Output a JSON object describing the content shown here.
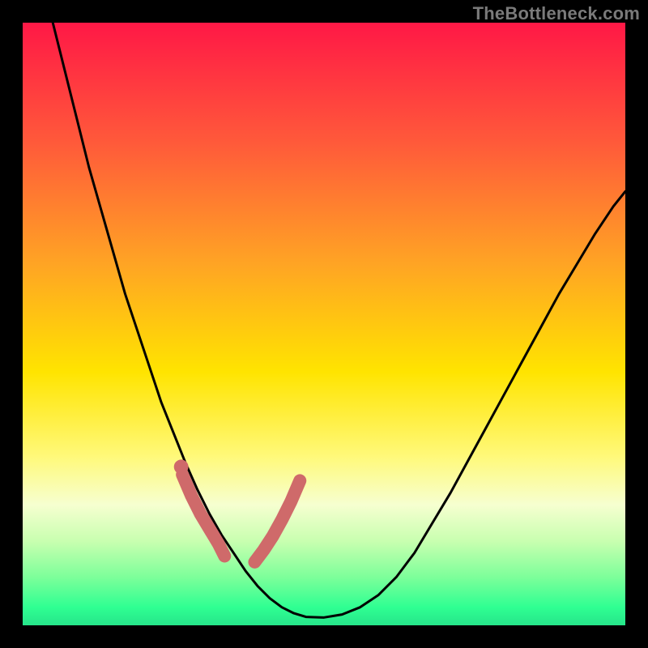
{
  "watermark": "TheBottleneck.com",
  "colors": {
    "frame_bg": "#000000",
    "curve": "#000000",
    "highlight": "#cf6a6a",
    "highlight_dot": "#cf6a6a"
  },
  "gradient_stops": [
    {
      "offset": 0.0,
      "color": "#ff1846"
    },
    {
      "offset": 0.2,
      "color": "#ff5a3a"
    },
    {
      "offset": 0.4,
      "color": "#ffa424"
    },
    {
      "offset": 0.58,
      "color": "#ffe400"
    },
    {
      "offset": 0.72,
      "color": "#fff97a"
    },
    {
      "offset": 0.8,
      "color": "#f6ffd0"
    },
    {
      "offset": 0.86,
      "color": "#c9ffb0"
    },
    {
      "offset": 0.92,
      "color": "#7dff9a"
    },
    {
      "offset": 0.97,
      "color": "#2fff92"
    },
    {
      "offset": 1.0,
      "color": "#26e58a"
    }
  ],
  "chart_data": {
    "type": "line",
    "title": "",
    "xlabel": "",
    "ylabel": "",
    "xlim": [
      0,
      100
    ],
    "ylim": [
      0,
      100
    ],
    "x": [
      5,
      7,
      9,
      11,
      13,
      15,
      17,
      19,
      21,
      23,
      25,
      27,
      29,
      31,
      33,
      35,
      37,
      39,
      41,
      43,
      45,
      47,
      50,
      53,
      56,
      59,
      62,
      65,
      68,
      71,
      74,
      77,
      80,
      83,
      86,
      89,
      92,
      95,
      98,
      100
    ],
    "values": [
      100,
      92,
      84,
      76,
      69,
      62,
      55,
      49,
      43,
      37,
      32,
      27,
      22.5,
      18.5,
      15,
      12,
      9,
      6.5,
      4.5,
      3,
      2,
      1.4,
      1.3,
      1.8,
      3,
      5,
      8,
      12,
      17,
      22,
      27.5,
      33,
      38.5,
      44,
      49.5,
      55,
      60,
      65,
      69.5,
      72
    ],
    "highlight_segments": {
      "left": {
        "x": [
          26.5,
          28,
          29.5,
          31,
          32.5,
          33.5
        ],
        "y": [
          25,
          21.5,
          18.5,
          16,
          13.5,
          11.5
        ]
      },
      "right": {
        "x": [
          38.5,
          40,
          41.5,
          43,
          44.5,
          46
        ],
        "y": [
          10.5,
          12.5,
          14.8,
          17.5,
          20.5,
          24
        ]
      },
      "dot": {
        "x": 26.3,
        "y": 26.3,
        "r": 1.2
      }
    },
    "note": "x and y are in percentage-of-plot units (0 at left/bottom, 100 at right/top). Values are read from the image by estimation; the figure has no axis ticks or numeric labels."
  }
}
